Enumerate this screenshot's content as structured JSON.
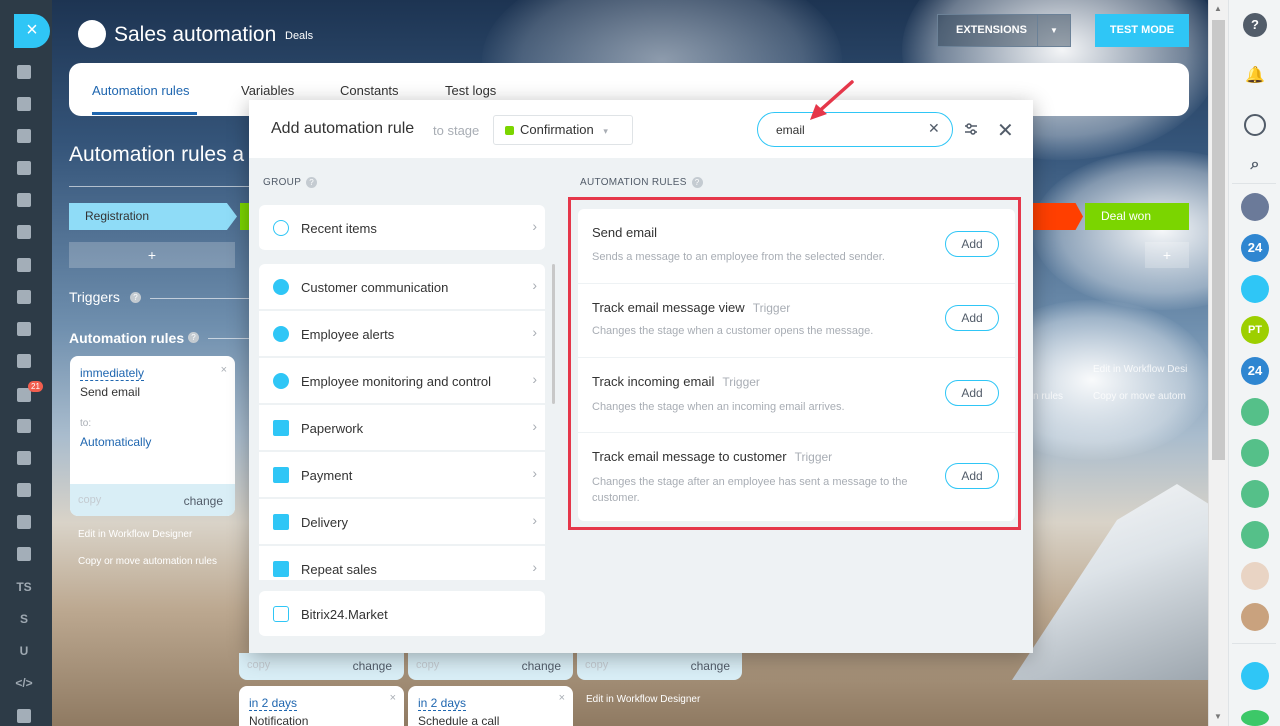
{
  "header": {
    "app_title": "Sales automation",
    "app_sub": "Deals",
    "extensions_label": "EXTENSIONS",
    "test_mode_label": "TEST MODE"
  },
  "tabs": [
    {
      "label": "Automation rules"
    },
    {
      "label": "Variables"
    },
    {
      "label": "Constants"
    },
    {
      "label": "Test logs"
    }
  ],
  "background": {
    "heading": "Automation rules a",
    "stage_registration": "Registration",
    "stage_deal_won": "Deal won",
    "plus": "+",
    "triggers": "Triggers",
    "automation_rules": "Automation rules",
    "card1": {
      "when": "immediately",
      "action": "Send email",
      "to_label": "to:",
      "to_value": "Automatically",
      "copy": "copy",
      "change": "change"
    },
    "edit_designer": "Edit in Workflow Designer",
    "copy_move": "Copy or move automation rules",
    "copy": "copy",
    "change": "change",
    "edit_designer_right": "Edit in Workflow Desi",
    "copy_move_right": "Copy or move autom",
    "n_rules": "n rules",
    "card_notification": {
      "when": "in 2 days",
      "action": "Notification"
    },
    "card_schedule": {
      "when": "in 2 days",
      "action": "Schedule a call"
    },
    "edit_designer_bottom": "Edit in Workflow Designer"
  },
  "left_sidebar": {
    "notification_count": "21",
    "ts": "TS",
    "s": "S",
    "u": "U",
    "code": "</>"
  },
  "right_sidebar": {
    "help": "?",
    "b24": "24",
    "pt": "PT"
  },
  "dialog": {
    "title": "Add automation rule",
    "to_stage": "to stage",
    "stage": "Confirmation",
    "search_value": "email",
    "group_header": "GROUP",
    "rules_header": "AUTOMATION RULES",
    "groups": [
      {
        "label": "Recent items"
      },
      {
        "label": "Customer communication"
      },
      {
        "label": "Employee alerts"
      },
      {
        "label": "Employee monitoring and control"
      },
      {
        "label": "Paperwork"
      },
      {
        "label": "Payment"
      },
      {
        "label": "Delivery"
      },
      {
        "label": "Repeat sales"
      },
      {
        "label": "Bitrix24.Market"
      }
    ],
    "rules": [
      {
        "title": "Send email",
        "tag": "",
        "desc": "Sends a message to an employee from the selected sender.",
        "add": "Add"
      },
      {
        "title": "Track email message view",
        "tag": "Trigger",
        "desc": "Changes the stage when a customer opens the message.",
        "add": "Add"
      },
      {
        "title": "Track incoming email",
        "tag": "Trigger",
        "desc": "Changes the stage when an incoming email arrives.",
        "add": "Add"
      },
      {
        "title": "Track email message to customer",
        "tag": "Trigger",
        "desc": "Changes the stage after an employee has sent a message to the customer.",
        "add": "Add"
      }
    ]
  },
  "colors": {
    "accent": "#2fc6f6",
    "link": "#2067b0",
    "highlight": "#e5374a",
    "stage_green": "#7bd500",
    "deal_lost": "#ff3f00"
  }
}
